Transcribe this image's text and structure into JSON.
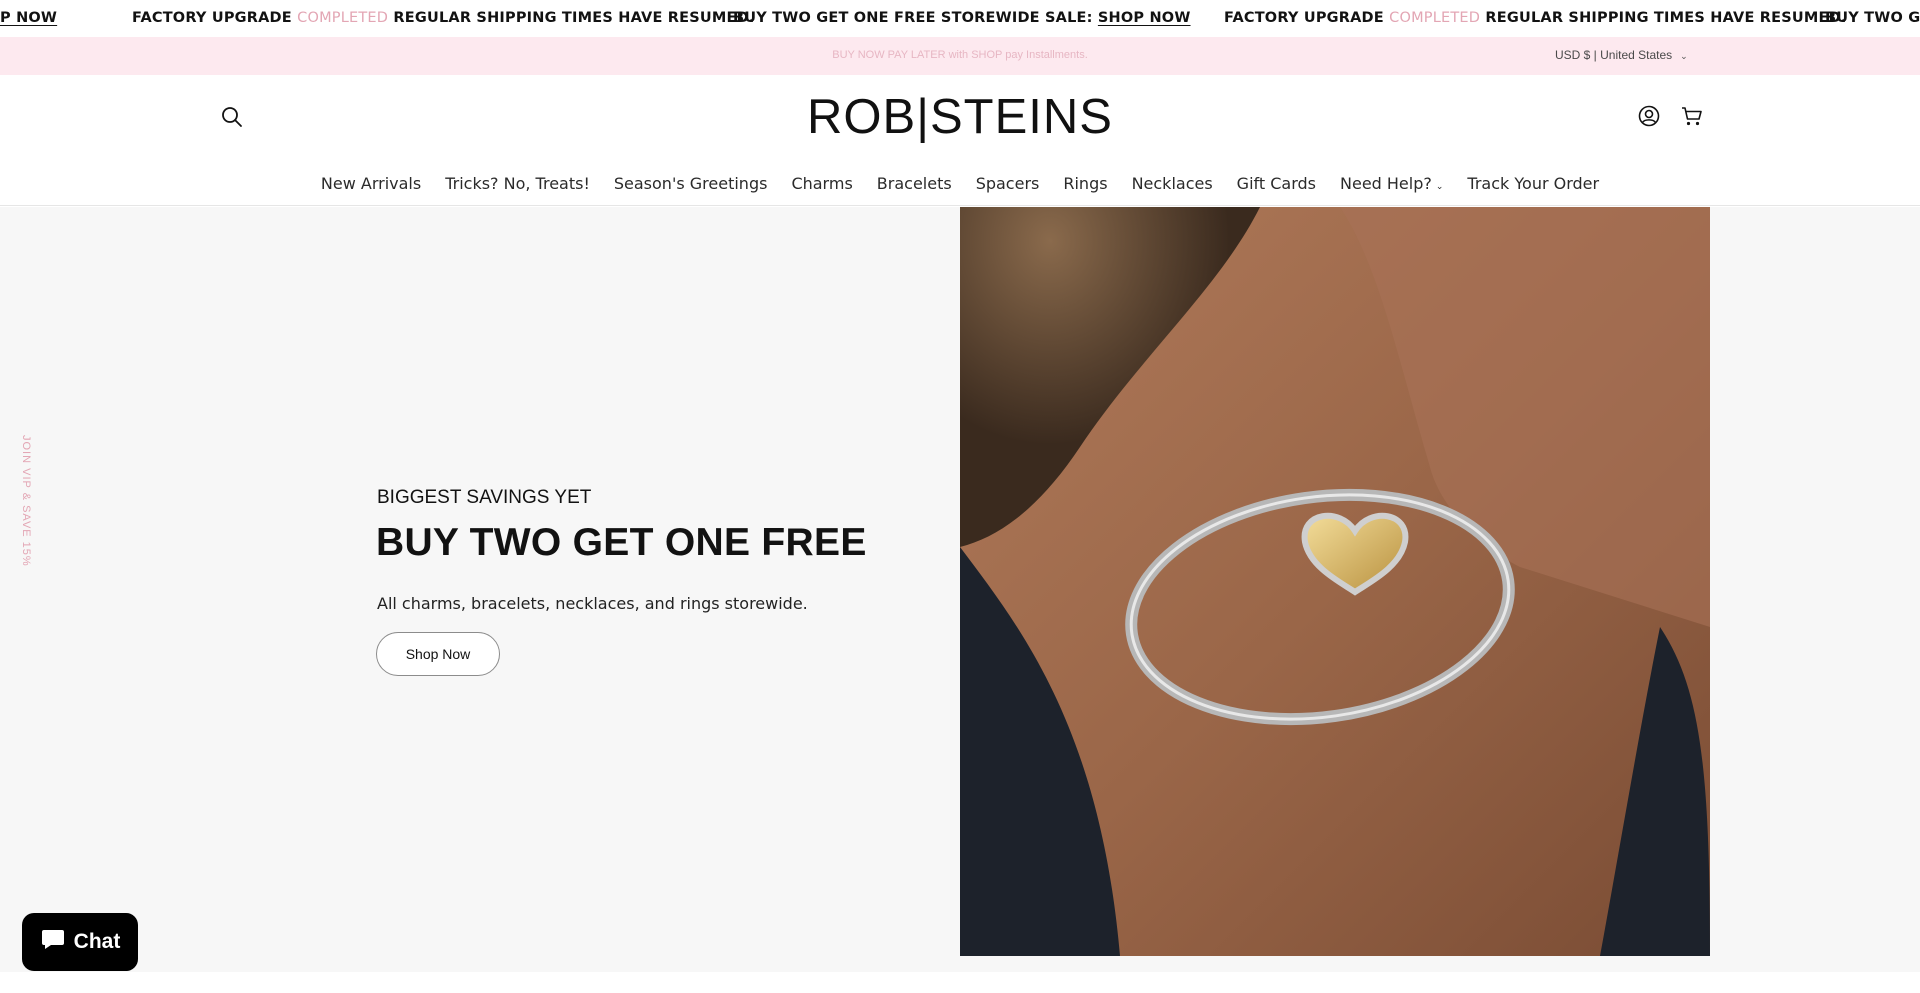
{
  "marquee": {
    "item1": "P NOW",
    "item2_prefix": "FACTORY UPGRADE",
    "item2_pink": "COMPLETED",
    "item2_suffix": "REGULAR SHIPPING TIMES HAVE RESUMED.",
    "item3_prefix": "BUY TWO GET ONE FREE STOREWIDE SALE:",
    "item3_link": "SHOP NOW",
    "item4_prefix": "FACTORY UPGRADE",
    "item4_pink": "COMPLETED",
    "item4_suffix": "REGULAR SHIPPING TIMES HAVE RESUMED.",
    "item5": "BUY TWO GE"
  },
  "promo": {
    "text": "BUY NOW PAY LATER with SHOP pay Installments.",
    "currency": "USD $ | United States"
  },
  "header": {
    "logo": "ROB|STEINS",
    "search_icon": "search-icon",
    "account_icon": "account-icon",
    "cart_icon": "cart-icon"
  },
  "nav": {
    "items": [
      "New Arrivals",
      "Tricks? No, Treats!",
      "Season's Greetings",
      "Charms",
      "Bracelets",
      "Spacers",
      "Rings",
      "Necklaces",
      "Gift Cards",
      "Need Help?",
      "Track Your Order"
    ]
  },
  "hero": {
    "subtitle": "BIGGEST SAVINGS YET",
    "title": "BUY TWO GET ONE FREE",
    "description": "All charms, bracelets, necklaces, and rings storewide.",
    "button": "Shop Now",
    "vip_tab": "JOIN VIP & SAVE 15%"
  },
  "chat": {
    "label": "Chat"
  },
  "colors": {
    "accent_pink": "#e3a6b4",
    "promo_bg": "#fde9ef",
    "hero_bg": "#f7f7f7"
  }
}
